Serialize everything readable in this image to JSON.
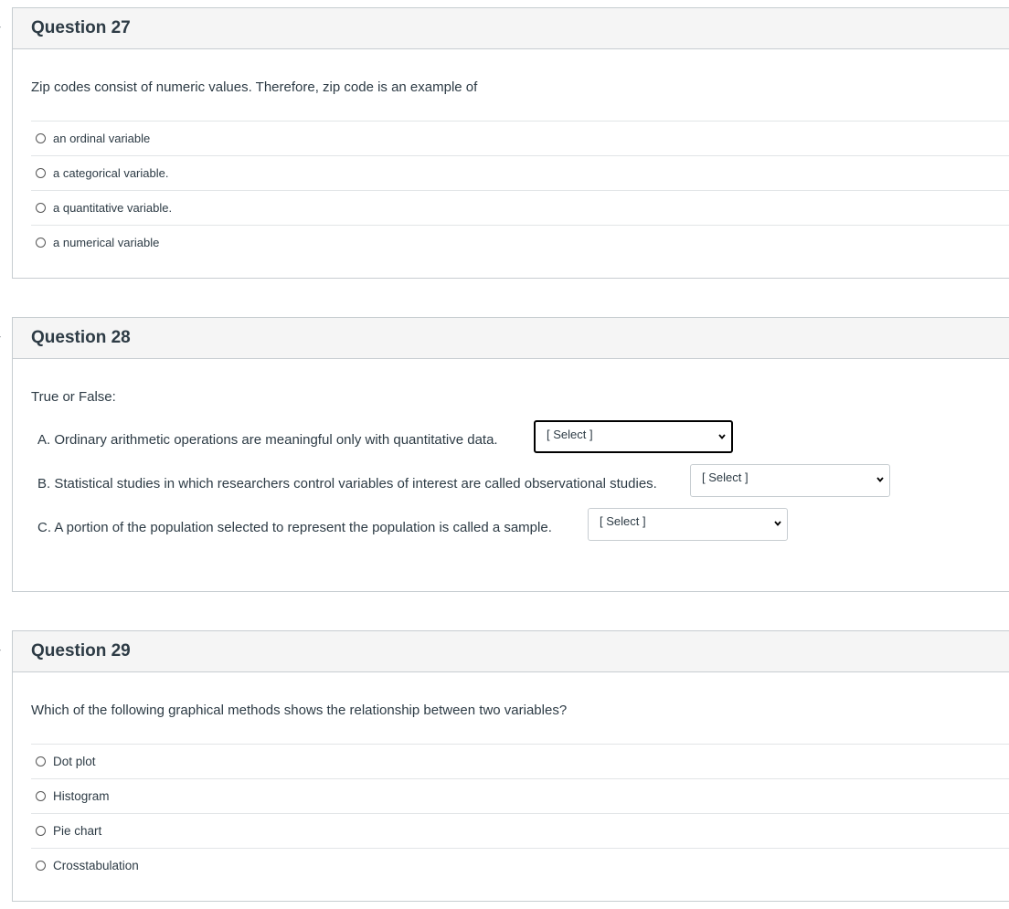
{
  "q27": {
    "title": "Question 27",
    "text": "Zip codes consist of numeric values. Therefore, zip code is an example of",
    "answers": [
      "an ordinal variable",
      "a categorical variable.",
      "a quantitative variable.",
      "a numerical variable"
    ]
  },
  "q28": {
    "title": "Question 28",
    "intro": "True or False:",
    "items": [
      {
        "text": "A. Ordinary arithmetic operations are meaningful only with quantitative data.",
        "select": "[ Select ]"
      },
      {
        "text": "B. Statistical studies in which researchers control variables of interest are called observational studies.",
        "select": "[ Select ]"
      },
      {
        "text": "C. A portion of the population selected to represent the population is called a sample.",
        "select": "[ Select ]"
      }
    ]
  },
  "q29": {
    "title": "Question 29",
    "text": "Which of the following graphical methods shows the relationship between two variables?",
    "answers": [
      "Dot plot",
      "Histogram",
      "Pie chart",
      "Crosstabulation"
    ]
  }
}
